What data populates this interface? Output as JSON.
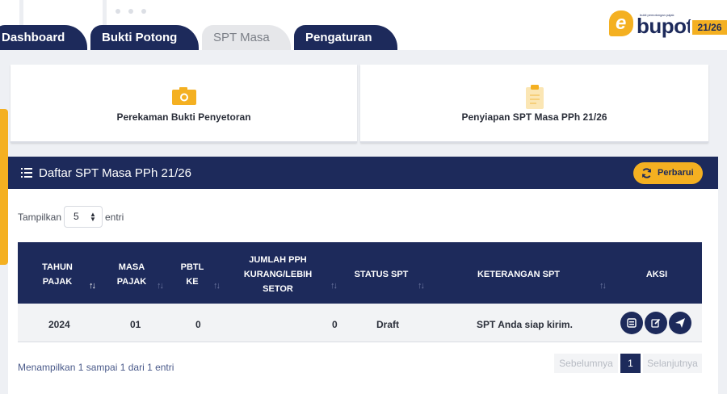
{
  "nav": {
    "tabs": [
      {
        "label": "Dashboard",
        "active": false
      },
      {
        "label": "Bukti Potong",
        "active": false
      },
      {
        "label": "SPT Masa",
        "active": true
      },
      {
        "label": "Pengaturan",
        "active": false
      }
    ]
  },
  "logo": {
    "word": "bupot",
    "letter": "e",
    "tagline": "bukti pemotongan pajak",
    "badge": "21/26"
  },
  "cards": [
    {
      "label": "Perekaman Bukti Penyetoran",
      "icon": "camera-icon"
    },
    {
      "label": "Penyiapan SPT Masa PPh 21/26",
      "icon": "clipboard-icon"
    }
  ],
  "panel": {
    "title": "Daftar SPT Masa PPh 21/26",
    "refresh_label": "Perbarui"
  },
  "length_menu": {
    "prefix": "Tampilkan",
    "value": "5",
    "suffix": "entri"
  },
  "table": {
    "columns": [
      [
        "TAHUN",
        "PAJAK"
      ],
      [
        "MASA",
        "PAJAK"
      ],
      [
        "PBTL",
        "KE"
      ],
      [
        "JUMLAH PPH",
        "KURANG/LEBIH",
        "SETOR"
      ],
      [
        "STATUS SPT"
      ],
      [
        "KETERANGAN SPT"
      ],
      [
        "AKSI"
      ]
    ],
    "rows": [
      {
        "tahun": "2024",
        "masa": "01",
        "pbtl": "0",
        "jumlah": "0",
        "status": "Draft",
        "keterangan": "SPT Anda siap kirim."
      }
    ],
    "actions": [
      "view-icon",
      "edit-icon",
      "send-icon"
    ]
  },
  "footer": {
    "info": "Menampilkan 1 sampai 1 dari 1 entri",
    "prev": "Sebelumnya",
    "page": "1",
    "next": "Selanjutnya"
  },
  "colors": {
    "navy": "#1d2a5b",
    "accent": "#f4b021",
    "background": "#eef0f4"
  }
}
